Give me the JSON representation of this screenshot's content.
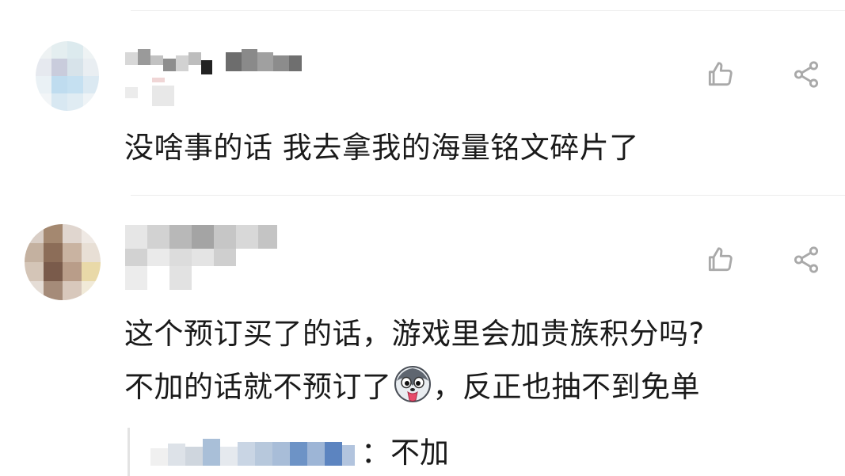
{
  "comments": [
    {
      "text": "没啥事的话 我去拿我的海量铭文碎片了",
      "like_icon": "thumbs-up-outline-icon",
      "share_icon": "share-icon"
    },
    {
      "line1": "这个预订买了的话，游戏里会加贵族积分吗?",
      "line2_before": "不加的话就不预订了",
      "emoji": "husky-tongue-emoji",
      "line2_after": "，反正也抽不到免单",
      "like_icon": "thumbs-up-outline-icon",
      "share_icon": "share-icon",
      "reply": {
        "separator_text": "：不加"
      }
    }
  ],
  "colors": {
    "divider": "#ececec",
    "icon": "#a9a9a9",
    "text": "#1a1a1a",
    "reply_bar": "#e3e3e3"
  }
}
